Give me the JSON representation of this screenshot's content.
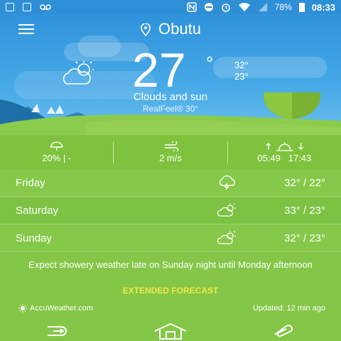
{
  "status_bar": {
    "battery": "78%",
    "time": "08:33",
    "icons": [
      "checkbox-icon",
      "checkbox-icon",
      "voicemail-icon",
      "nfc-icon",
      "do-not-disturb-icon",
      "alarm-icon",
      "wifi-icon",
      "signal-icon",
      "battery-icon"
    ]
  },
  "header": {
    "location": "Obutu"
  },
  "current": {
    "temp": "27",
    "degree_mark": "°",
    "high": "32°",
    "low": "23°",
    "condition": "Clouds and sun",
    "realfeel": "RealFeel® 30°",
    "icon": "partly-cloudy-icon"
  },
  "stats": {
    "precip": "20% | -",
    "wind": "2 m/s",
    "sunrise": "05:49",
    "sunset": "17:43"
  },
  "forecast": [
    {
      "day": "Friday",
      "icon": "thunderstorm-icon",
      "temps": "32° / 22°"
    },
    {
      "day": "Saturday",
      "icon": "partly-cloudy-icon",
      "temps": "33° / 23°"
    },
    {
      "day": "Sunday",
      "icon": "partly-cloudy-icon",
      "temps": "32° / 23°"
    }
  ],
  "summary": "Expect showery weather late on Sunday night until Monday afternoon",
  "extended_label": "EXTENDED FORECAST",
  "brand": "AccuWeather.com",
  "updated": "Updated: 12 min ago",
  "colors": {
    "sky": "#3a9fe0",
    "grass": "#84c647",
    "accent_yellow": "#f2e84a"
  }
}
